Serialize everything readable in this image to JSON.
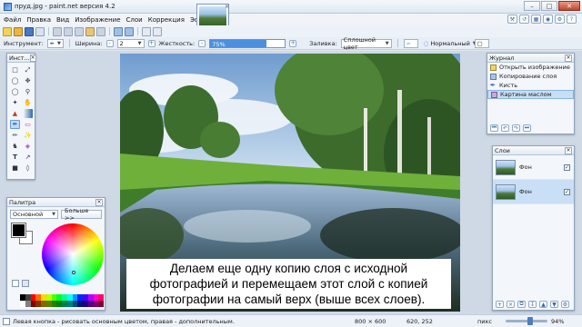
{
  "window": {
    "title": "пруд.jpg - paint.net версия 4.2"
  },
  "menu": {
    "items": [
      "Файл",
      "Правка",
      "Вид",
      "Изображение",
      "Слои",
      "Коррекция",
      "Эффекты"
    ]
  },
  "toolbar2": {
    "tool_label": "Инструмент:",
    "width_label": "Ширина:",
    "width_value": "2",
    "hardness_label": "Жесткость:",
    "hardness_value": "75%",
    "hardness_fraction": 0.75,
    "fill_label": "Заливка:",
    "fill_value": "Сплошной цвет",
    "blend_value": "Нормальный"
  },
  "tools_panel": {
    "title": "Инст..."
  },
  "palette": {
    "title": "Палитра",
    "mode": "Основной",
    "more_label": "Больше >>",
    "primary_color": "#000000",
    "secondary_color": "#ffffff"
  },
  "history": {
    "title": "Журнал",
    "items": [
      "Открыть изображение",
      "Копирование слоя",
      "Кисть",
      "Картина маслом"
    ],
    "selected_index": 3
  },
  "layers": {
    "title": "Слои",
    "items": [
      {
        "name": "Фон",
        "visible": "✓"
      },
      {
        "name": "Фон",
        "visible": "✓"
      }
    ]
  },
  "caption": {
    "line1": "Делаем еще одну копию слоя с исходной",
    "line2": "фотографией и перемещаем этот слой с копией",
    "line3": "фотографии на самый верх (выше всех слоев)."
  },
  "status": {
    "hint": "Левая кнопка - рисовать основным цветом, правая - дополнительным.",
    "size": "800 × 600",
    "coords": "620, 252",
    "units": "пикс",
    "zoom": "94%",
    "zoom_fraction": 0.6
  }
}
